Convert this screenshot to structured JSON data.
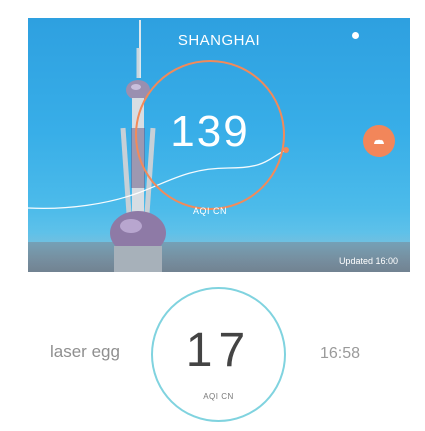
{
  "hero": {
    "city": "SHANGHAI",
    "aqi_value": "139",
    "aqi_label": "AQI CN",
    "updated": "Updated 16:00",
    "badge_icon": "sad-face-icon",
    "colors": {
      "accent": "#f28a5a",
      "sky": "#38aee8"
    }
  },
  "device": {
    "name": "laser egg",
    "aqi_value": "17",
    "aqi_label": "AQI CN",
    "time": "16:58",
    "colors": {
      "ring": "#80d3df"
    }
  }
}
